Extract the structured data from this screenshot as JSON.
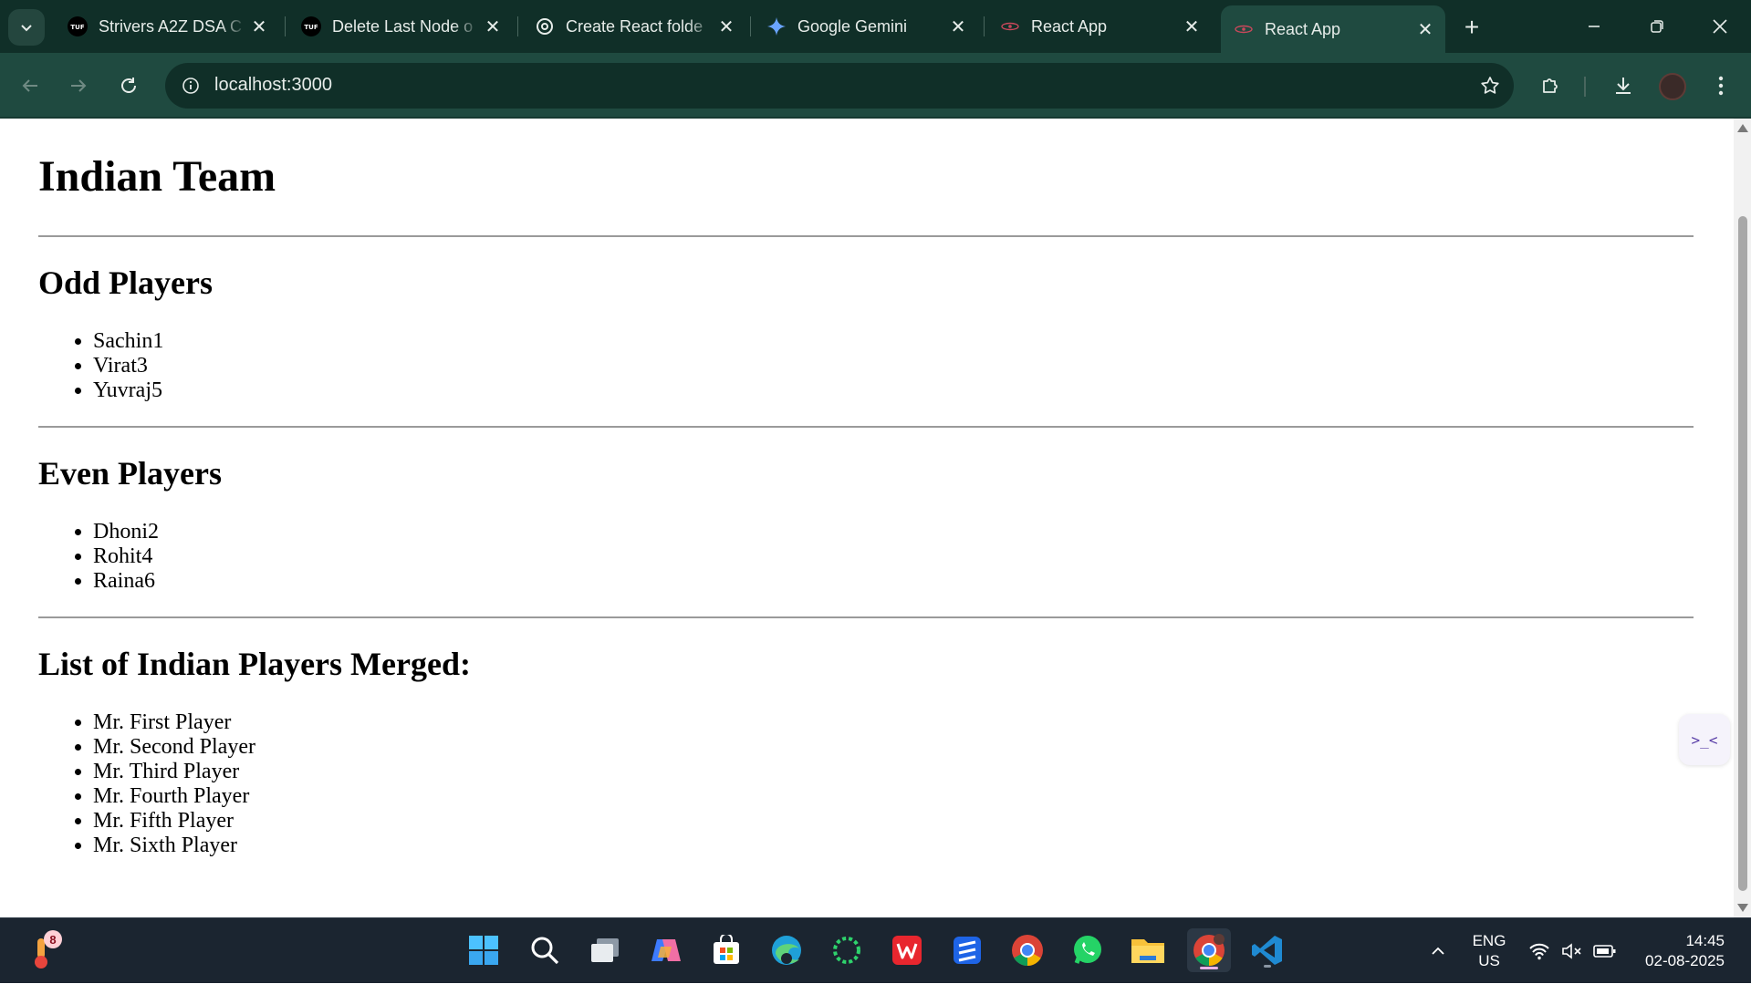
{
  "browser": {
    "tabs": [
      {
        "title": "Strivers A2Z DSA C",
        "favicon": "tuf-icon"
      },
      {
        "title": "Delete Last Node o",
        "favicon": "tuf-icon"
      },
      {
        "title": "Create React folde",
        "favicon": "chatgpt-icon"
      },
      {
        "title": "Google Gemini",
        "favicon": "gemini-icon"
      },
      {
        "title": "React App",
        "favicon": "react-icon"
      },
      {
        "title": "React App",
        "favicon": "react-icon",
        "active": true
      }
    ],
    "url": "localhost:3000",
    "colors": {
      "frame": "#102f28",
      "toolbar": "#1f4a40"
    }
  },
  "page": {
    "title": "Indian Team",
    "sections": [
      {
        "heading": "Odd Players",
        "items": [
          "Sachin1",
          "Virat3",
          "Yuvraj5"
        ]
      },
      {
        "heading": "Even Players",
        "items": [
          "Dhoni2",
          "Rohit4",
          "Raina6"
        ]
      },
      {
        "heading": "List of Indian Players Merged:",
        "items": [
          "Mr. First Player",
          "Mr. Second Player",
          "Mr. Third Player",
          "Mr. Fourth Player",
          "Mr. Fifth Player",
          "Mr. Sixth Player"
        ]
      }
    ]
  },
  "taskbar": {
    "weather_badge": "8",
    "apps": [
      "start-icon",
      "search-icon",
      "task-view-icon",
      "copilot-icon",
      "microsoft-store-icon",
      "edge-icon",
      "loader-app-icon",
      "wps-office-icon",
      "app-stack-icon",
      "chrome-icon",
      "whatsapp-icon",
      "file-explorer-icon",
      "chrome-profile-icon",
      "vscode-icon"
    ],
    "lang_line1": "ENG",
    "lang_line2": "US",
    "time": "14:45",
    "date": "02-08-2025"
  }
}
